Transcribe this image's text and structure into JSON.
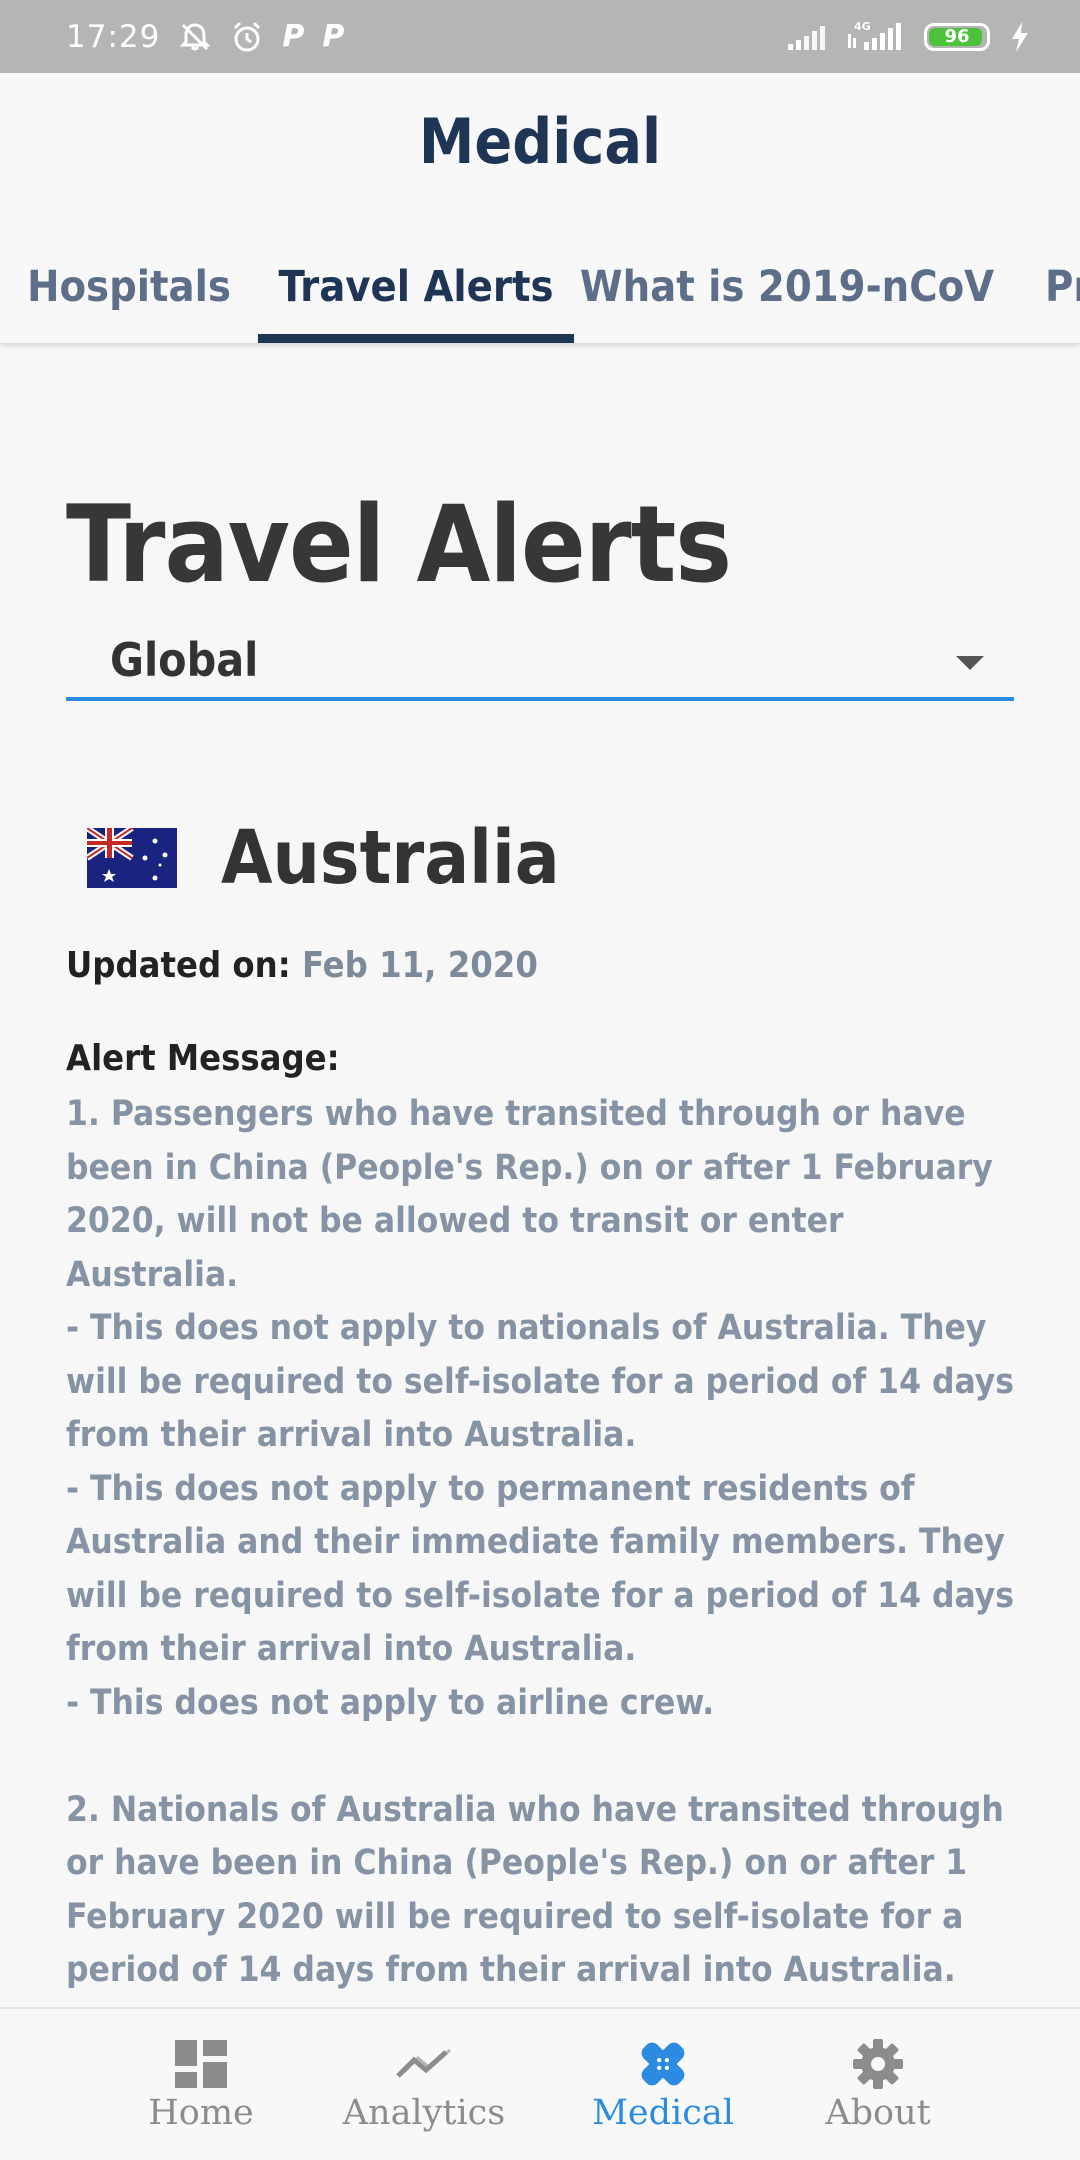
{
  "status_bar": {
    "time": "17:29",
    "battery": "96",
    "network": "4G"
  },
  "header": {
    "title": "Medical",
    "tabs": [
      {
        "label": "Hospitals"
      },
      {
        "label": "Travel Alerts"
      },
      {
        "label": "What is 2019-nCoV"
      },
      {
        "label": "Pr"
      }
    ],
    "active_tab": "Travel Alerts"
  },
  "main": {
    "heading": "Travel Alerts",
    "region": "Global",
    "country": "Australia",
    "updated_label": "Updated on:",
    "updated_date": "Feb 11, 2020",
    "alert_label": "Alert Message:",
    "alert_message": "1. Passengers who have transited through or have been in China (People's Rep.) on or after 1 February 2020, will not be allowed to transit or enter Australia.\n- This does not apply to nationals of Australia. They will be required to self-isolate for a period of 14 days from their arrival into Australia.\n- This does not apply to permanent residents of Australia and their immediate family members. They will be required to self-isolate for a period of 14 days from their arrival into Australia.\n- This does not apply to airline crew.\n\n2. Nationals of Australia who have transited through or have been in China (People's Rep.) on or after 1 February 2020 will be required to self-isolate for a period of 14 days from their arrival into Australia."
  },
  "bottom_nav": {
    "items": [
      {
        "label": "Home",
        "icon": "dashboard-icon"
      },
      {
        "label": "Analytics",
        "icon": "trending-icon"
      },
      {
        "label": "Medical",
        "icon": "bandage-icon"
      },
      {
        "label": "About",
        "icon": "gear-icon"
      }
    ],
    "active": "Medical"
  },
  "colors": {
    "brand": "#1e3556",
    "accent": "#2b8be0",
    "muted_text": "#8593a4",
    "battery": "#4cc13a"
  }
}
